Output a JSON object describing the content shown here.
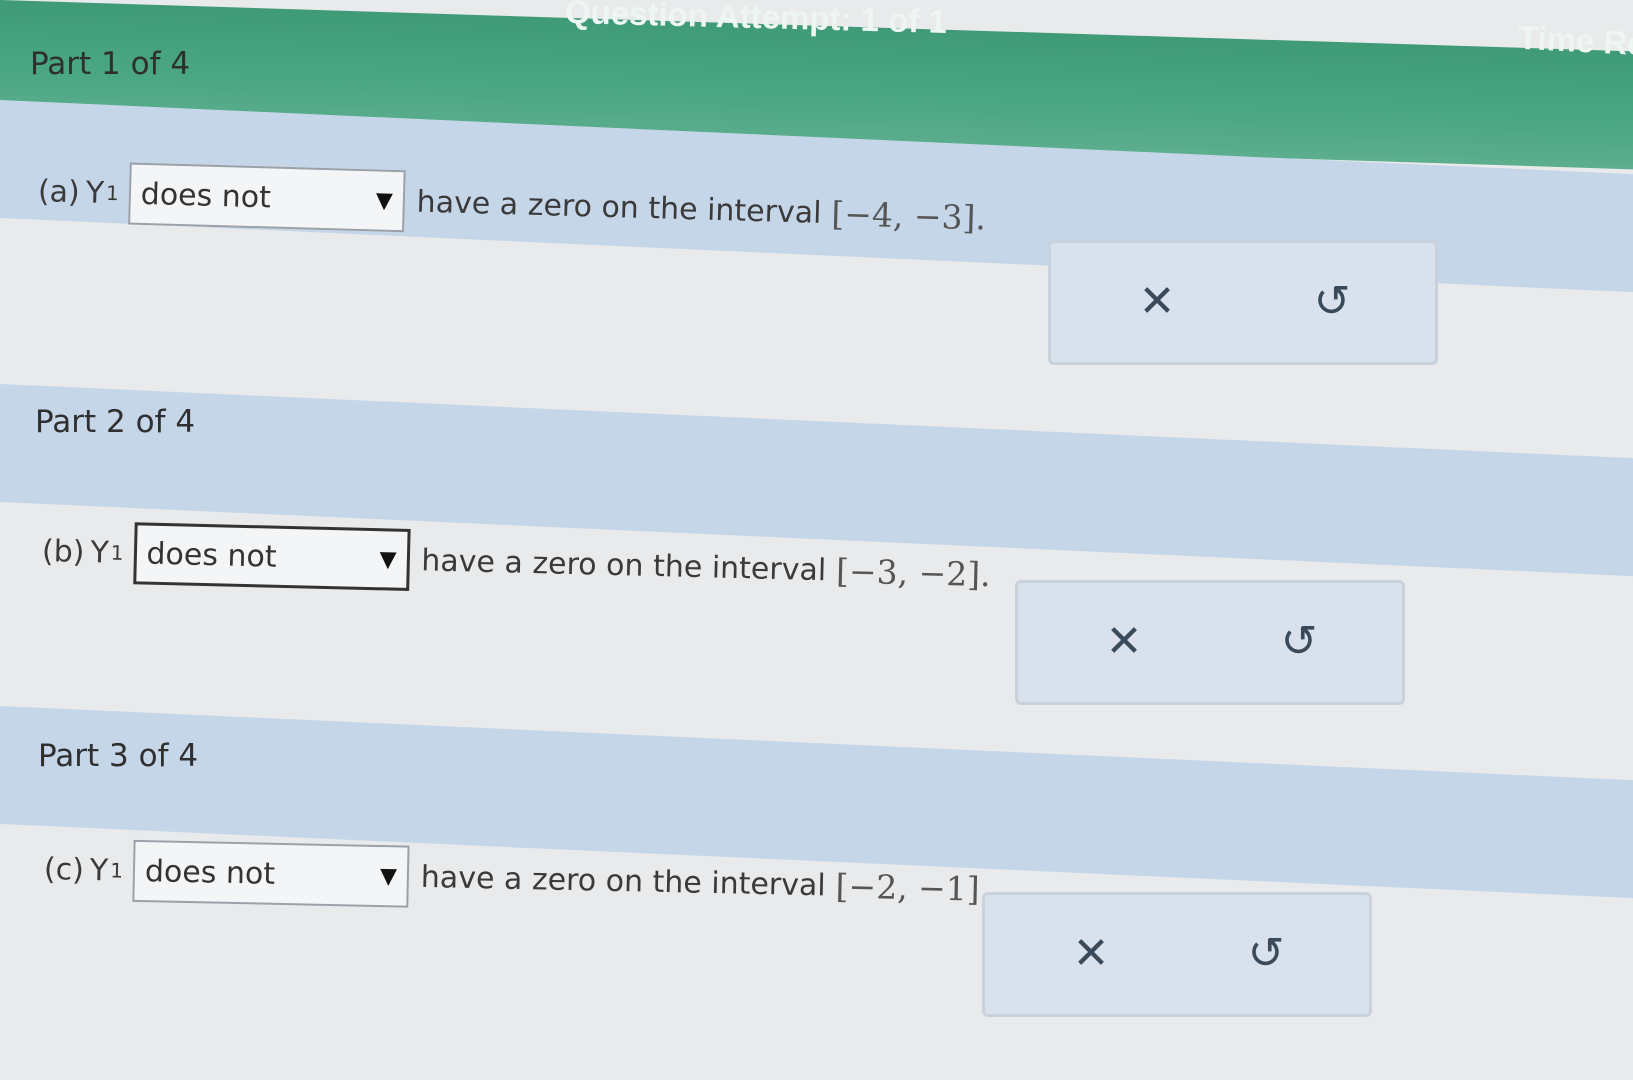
{
  "header": {
    "attempt_text": "Question Attempt: 1 of 1",
    "time_text": "Time Re"
  },
  "parts": [
    {
      "label": "Part 1 of 4",
      "question_label": "(a)",
      "variable": "Y",
      "subscript": "1",
      "selected_value": "does not",
      "statement": "have a zero on the interval",
      "interval": "[−4, −3]."
    },
    {
      "label": "Part 2 of 4",
      "question_label": "(b)",
      "variable": "Y",
      "subscript": "1",
      "selected_value": "does not",
      "statement": "have a zero on the interval",
      "interval": "[−3, −2]."
    },
    {
      "label": "Part 3 of 4",
      "question_label": "(c)",
      "variable": "Y",
      "subscript": "1",
      "selected_value": "does not",
      "statement": "have a zero on the interval",
      "interval": "[−2, −1]."
    }
  ],
  "icons": {
    "clear": "close-icon",
    "undo": "undo-icon"
  },
  "colors": {
    "header_green": "#4aa683",
    "part_band_blue": "#c6d6e9",
    "answer_box": "#d9e2ec"
  }
}
